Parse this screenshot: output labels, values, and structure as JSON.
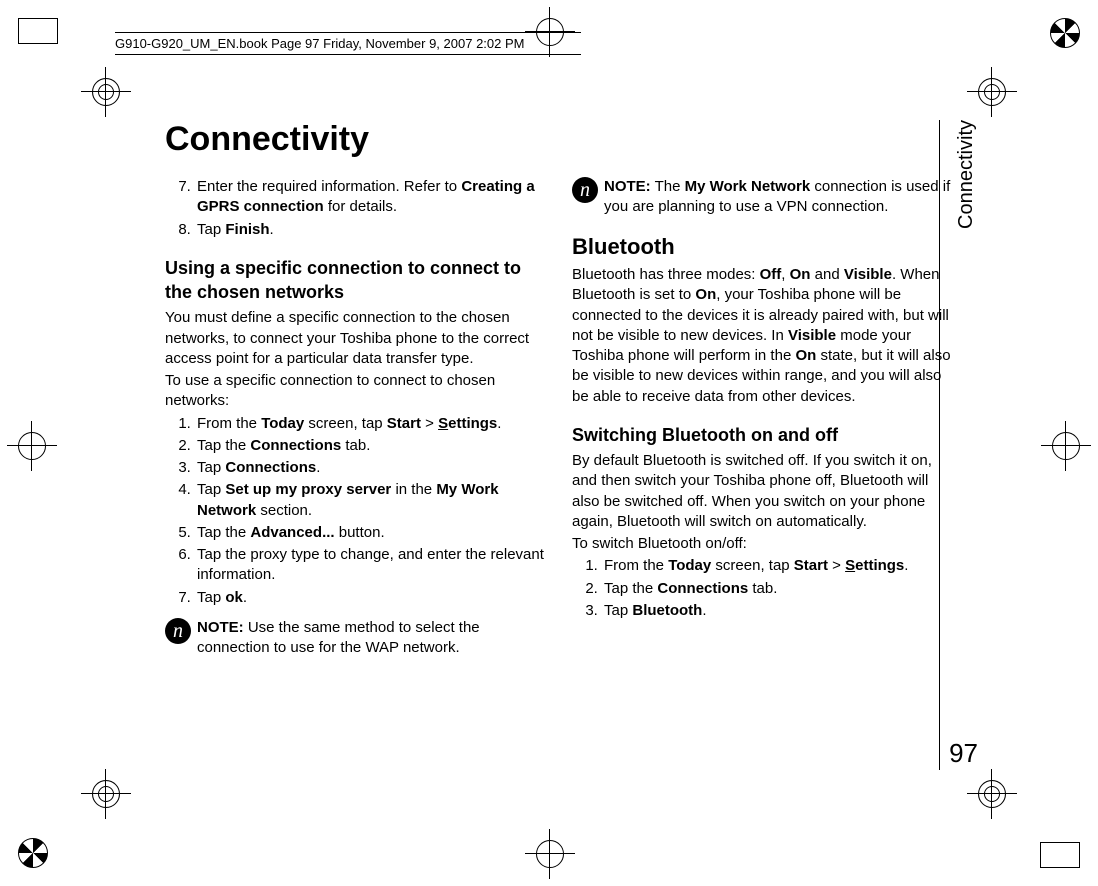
{
  "runner": "G910-G920_UM_EN.book  Page 97  Friday, November 9, 2007  2:02 PM",
  "title": "Connectivity",
  "side_tab": "Connectivity",
  "page_number": "97",
  "col1": {
    "steps_a": [
      {
        "n": "7.",
        "pre": "Enter the required information. Refer to ",
        "bold": "Creating a GPRS connection",
        "post": " for details."
      },
      {
        "n": "8.",
        "pre": "Tap ",
        "bold": "Finish",
        "post": "."
      }
    ],
    "h3": "Using a specific connection to connect to the chosen networks",
    "p1": "You must define a specific connection to the chosen networks, to connect your Toshiba phone to the correct access point for a particular data transfer type.",
    "p2": "To use a specific connection to connect to chosen networks:",
    "steps_b": [
      {
        "text": "From the ",
        "b1": "Today",
        "mid": " screen, tap ",
        "b2": "Start",
        "gt": " > ",
        "b3u": "S",
        "b3": "ettings",
        "post": "."
      },
      {
        "text": "Tap the ",
        "b1": "Connections",
        "post": " tab."
      },
      {
        "text": "Tap ",
        "b1": "Connections",
        "post": "."
      },
      {
        "text": "Tap ",
        "b1": "Set up my proxy server",
        "mid": " in the ",
        "b2": "My Work Network",
        "post": " section."
      },
      {
        "text": "Tap the ",
        "b1": "Advanced...",
        "post": " button."
      },
      {
        "text": "Tap the proxy type to change, and enter the relevant information."
      },
      {
        "text": "Tap ",
        "b1": "ok",
        "post": "."
      }
    ],
    "note": {
      "label": "NOTE:",
      "body": " Use the same method to select the connection to use for the WAP network."
    }
  },
  "col2": {
    "note": {
      "label": "NOTE:",
      "body_pre": " The ",
      "bold": "My Work Network",
      "body_post": " connection is used if you are planning to use a VPN connection."
    },
    "h2": "Bluetooth",
    "bt_para": {
      "t1": "Bluetooth has three modes: ",
      "b1": "Off",
      "c1": ", ",
      "b2": "On",
      "c2": " and ",
      "b3": "Visible",
      "t2": ". When Bluetooth is set to ",
      "b4": "On",
      "t3": ", your Toshiba phone will be connected to the devices it is already paired with, but will not be visible to new devices. In ",
      "b5": "Visible",
      "t4": " mode your Toshiba phone will perform in the ",
      "b6": "On",
      "t5": " state, but it will also be visible to new devices within range, and you will also be able to receive data from other devices."
    },
    "h3": "Switching Bluetooth on and off",
    "p1": "By default Bluetooth is switched off. If you switch it on, and then switch your Toshiba phone off, Bluetooth will also be switched off. When you switch on your phone again, Bluetooth will switch on automatically.",
    "p2": "To switch Bluetooth on/off:",
    "steps": [
      {
        "text": "From the ",
        "b1": "Today",
        "mid": " screen, tap ",
        "b2": "Start",
        "gt": " > ",
        "b3u": "S",
        "b3": "ettings",
        "post": "."
      },
      {
        "text": "Tap the ",
        "b1": "Connections",
        "post": " tab."
      },
      {
        "text": "Tap ",
        "b1": "Bluetooth",
        "post": "."
      }
    ]
  }
}
